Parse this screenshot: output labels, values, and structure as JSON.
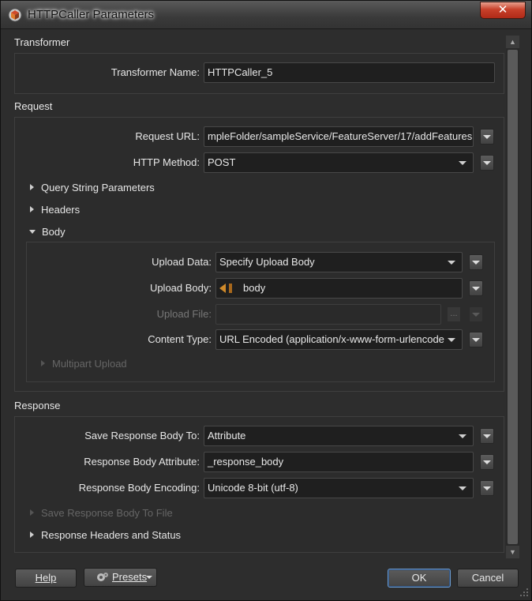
{
  "window": {
    "title": "HTTPCaller Parameters",
    "close_glyph": "✕"
  },
  "transformer": {
    "section_title": "Transformer",
    "name_label": "Transformer Name:",
    "name_value": "HTTPCaller_5"
  },
  "request": {
    "section_title": "Request",
    "url_label": "Request URL:",
    "url_value": "mpleFolder/sampleService/FeatureServer/17/addFeatures",
    "method_label": "HTTP Method:",
    "method_value": "POST",
    "query_string_label": "Query String Parameters",
    "headers_label": "Headers",
    "body": {
      "label": "Body",
      "upload_data_label": "Upload Data:",
      "upload_data_value": "Specify Upload Body",
      "upload_body_label": "Upload Body:",
      "upload_body_value": "body",
      "upload_file_label": "Upload File:",
      "upload_file_value": "",
      "ellipsis": "...",
      "content_type_label": "Content Type:",
      "content_type_value": "URL Encoded (application/x-www-form-urlencode",
      "multipart_label": "Multipart Upload"
    }
  },
  "response": {
    "section_title": "Response",
    "save_to_label": "Save Response Body To:",
    "save_to_value": "Attribute",
    "attribute_label": "Response Body Attribute:",
    "attribute_value": "_response_body",
    "encoding_label": "Response Body Encoding:",
    "encoding_value": "Unicode 8-bit (utf-8)",
    "save_to_file_label": "Save Response Body To File",
    "headers_status_label": "Response Headers and Status"
  },
  "footer": {
    "help_label": "Help",
    "presets_label": "Presets",
    "ok_label": "OK",
    "cancel_label": "Cancel"
  },
  "icons": {
    "app": "fme-transformer-icon",
    "attribute": "attribute-arrow-icon",
    "presets": "gear-icon"
  },
  "colors": {
    "close_button": "#c8402a",
    "attribute_icon": "#d08a2a",
    "default_button_border": "#6b9bd0"
  }
}
